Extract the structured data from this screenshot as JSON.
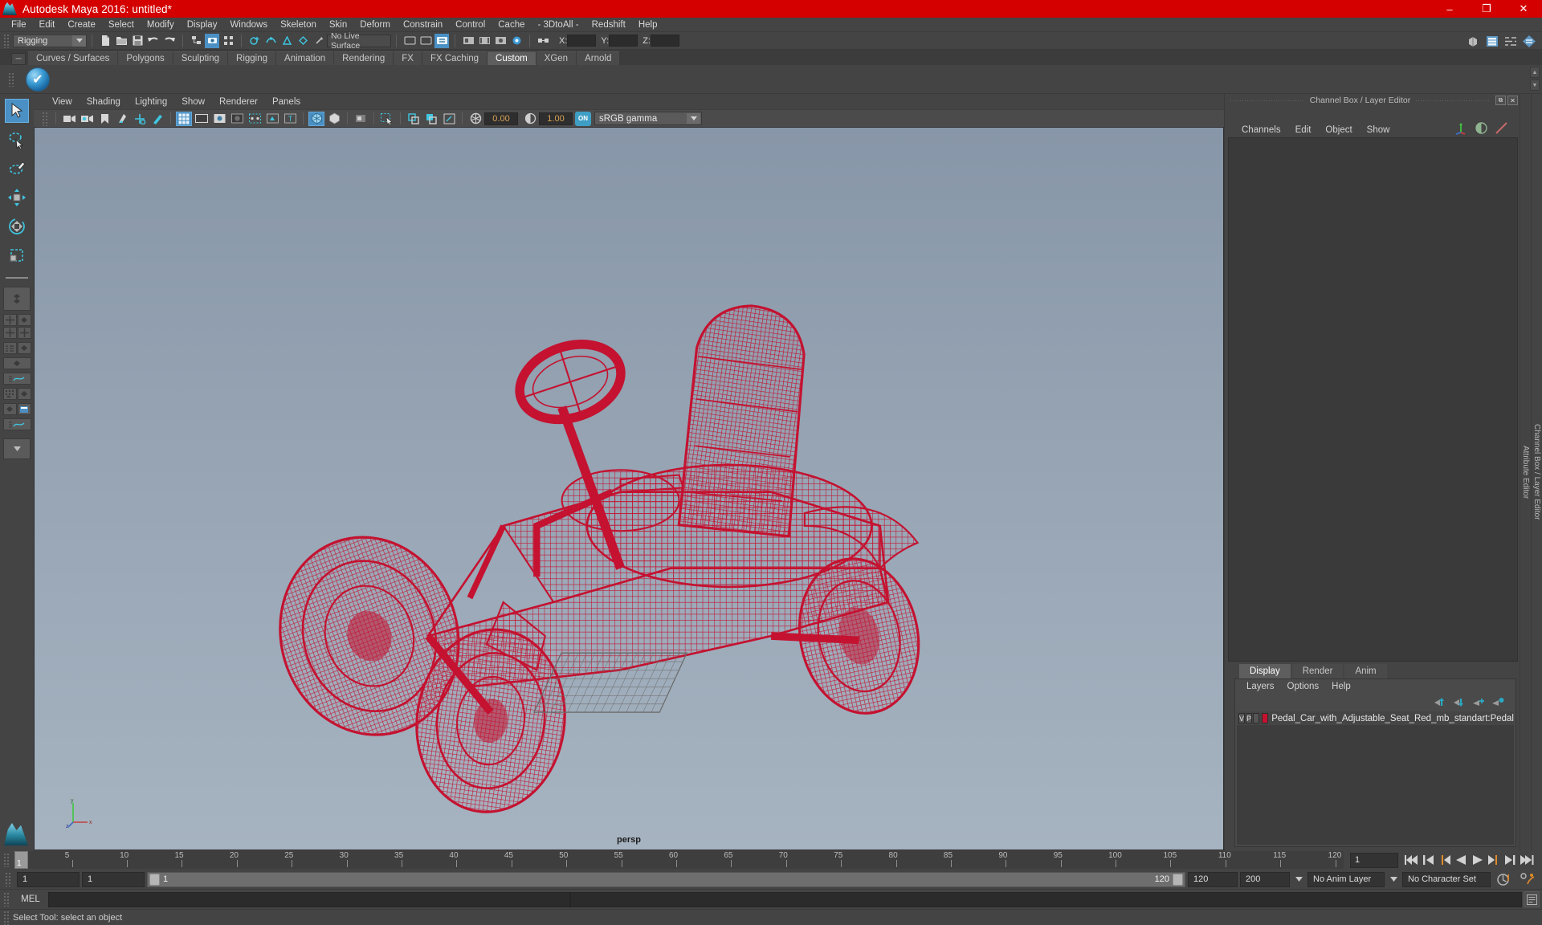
{
  "window": {
    "title": "Autodesk Maya 2016: untitled*",
    "logo_icon": "maya-logo-icon",
    "minimize_label": "–",
    "maximize_label": "❐",
    "close_label": "✕"
  },
  "menubar": {
    "items": [
      "File",
      "Edit",
      "Create",
      "Select",
      "Modify",
      "Display",
      "Windows",
      "Skeleton",
      "Skin",
      "Deform",
      "Constrain",
      "Control",
      "Cache",
      "- 3DtoAll -",
      "Redshift",
      "Help"
    ]
  },
  "statusline": {
    "mode": "Rigging",
    "live_surface": "No Live Surface",
    "icons": [
      "new-scene-icon",
      "open-scene-icon",
      "save-scene-icon",
      "undo-icon",
      "redo-icon",
      "select-by-hierarchy-icon",
      "select-by-object-icon",
      "select-by-component-icon",
      "snap-to-grid-icon",
      "snap-to-curve-icon",
      "snap-to-point-icon",
      "snap-to-plane-icon",
      "snap-to-view-plane-icon",
      "make-live-icon",
      "show-hide-editors-icon"
    ],
    "x_label": "X:",
    "y_label": "Y:",
    "z_label": "Z:",
    "x_value": "",
    "y_value": "",
    "z_value": "",
    "right_icons": [
      "modeling-toolkit-icon",
      "attribute-editor-icon",
      "tool-settings-icon",
      "channel-box-icon"
    ]
  },
  "shelf": {
    "tabs": [
      "Curves / Surfaces",
      "Polygons",
      "Sculpting",
      "Rigging",
      "Animation",
      "Rendering",
      "FX",
      "FX Caching",
      "Custom",
      "XGen",
      "Arnold"
    ],
    "active_tab": "Custom",
    "buttons": [
      {
        "name": "checkmark-blue-icon",
        "label": ""
      }
    ]
  },
  "toolbox": {
    "items": [
      {
        "name": "select-tool",
        "label": "Select Tool",
        "selected": true
      },
      {
        "name": "lasso-select-tool",
        "label": "Lasso Select Tool",
        "selected": false
      },
      {
        "name": "paint-select-tool",
        "label": "Paint Select Tool",
        "selected": false
      },
      {
        "name": "move-tool",
        "label": "Move Tool",
        "selected": false
      },
      {
        "name": "rotate-tool",
        "label": "Rotate Tool",
        "selected": false
      },
      {
        "name": "scale-tool",
        "label": "Scale Tool",
        "selected": false
      }
    ],
    "layouts": [
      "single-perspective-layout",
      "four-view-layout",
      "two-pane-layout",
      "outliner-persp-layout",
      "graph-editor-layout",
      "hypershade-layout",
      "persp-graph-layout",
      "more-layouts"
    ]
  },
  "viewport": {
    "menus": [
      "View",
      "Shading",
      "Lighting",
      "Show",
      "Renderer",
      "Panels"
    ],
    "toolbar_icons": [
      "select-camera-icon",
      "camera-attributes-icon",
      "bookmark-icon",
      "image-plane-icon",
      "two-d-pan-zoom-icon",
      "oil-paint-icon",
      "grid-toggle-icon",
      "film-gate-icon",
      "resolution-gate-icon",
      "gate-mask-icon",
      "xray-joints-icon",
      "xray-icon",
      "texture-toggle-icon",
      "wireframe-on-shaded-icon",
      "smooth-shade-icon",
      "isolate-select-icon",
      "exposure-icon",
      "gamma-icon",
      "color-management-icon"
    ],
    "exposure_value": "0.00",
    "gamma_value": "1.00",
    "color_mgmt_on": "ON",
    "color_profile": "sRGB gamma",
    "camera_label": "persp",
    "axis_labels": {
      "x": "x",
      "y": "y",
      "z": "z"
    },
    "object_color": "#c41230",
    "background_top": "#8796a8",
    "background_bottom": "#a6b3c0"
  },
  "channelbox": {
    "panel_title": "Channel Box / Layer Editor",
    "menus": [
      "Channels",
      "Edit",
      "Object",
      "Show"
    ],
    "float_label": "⧉",
    "close_label": "✕",
    "side_labels": [
      "Attribute Editor",
      "Channel Box / Layer Editor"
    ],
    "header_icons": [
      "transform-channels-icon",
      "shape-channels-icon",
      "history-icon"
    ]
  },
  "layereditor": {
    "tabs": [
      "Display",
      "Render",
      "Anim"
    ],
    "active_tab": "Display",
    "menus": [
      "Layers",
      "Options",
      "Help"
    ],
    "toolbar_icons": [
      "move-layer-up-icon",
      "move-layer-down-icon",
      "new-layer-icon",
      "new-layer-from-selected-icon"
    ],
    "layers": [
      {
        "visibility": "V",
        "playback": "P",
        "reference": "",
        "color": "#c41230",
        "name": "Pedal_Car_with_Adjustable_Seat_Red_mb_standart:Pedal"
      }
    ]
  },
  "timeline": {
    "ticks": [
      "5",
      "10",
      "15",
      "20",
      "25",
      "30",
      "35",
      "40",
      "45",
      "50",
      "55",
      "60",
      "65",
      "70",
      "75",
      "80",
      "85",
      "90",
      "95",
      "100",
      "105",
      "110",
      "115",
      "120"
    ],
    "start_label": "1",
    "current_frame": "1",
    "playback_icons": [
      "go-to-start-icon",
      "step-back-frame-icon",
      "step-back-key-icon",
      "play-backwards-icon",
      "play-forwards-icon",
      "step-forward-key-icon",
      "step-forward-frame-icon",
      "go-to-end-icon"
    ]
  },
  "rangeslider": {
    "anim_start": "1",
    "range_start": "1",
    "bar_start_label": "1",
    "bar_end_label": "120",
    "range_end": "120",
    "anim_end": "200",
    "anim_layer": "No Anim Layer",
    "character_set": "No Character Set",
    "auto_key_icon": "auto-keyframe-icon",
    "pref_icon": "animation-preferences-icon"
  },
  "commandline": {
    "label": "MEL",
    "input_value": "",
    "output_value": "",
    "script_editor_icon": "script-editor-icon"
  },
  "statusbar": {
    "message": "Select Tool: select an object"
  }
}
